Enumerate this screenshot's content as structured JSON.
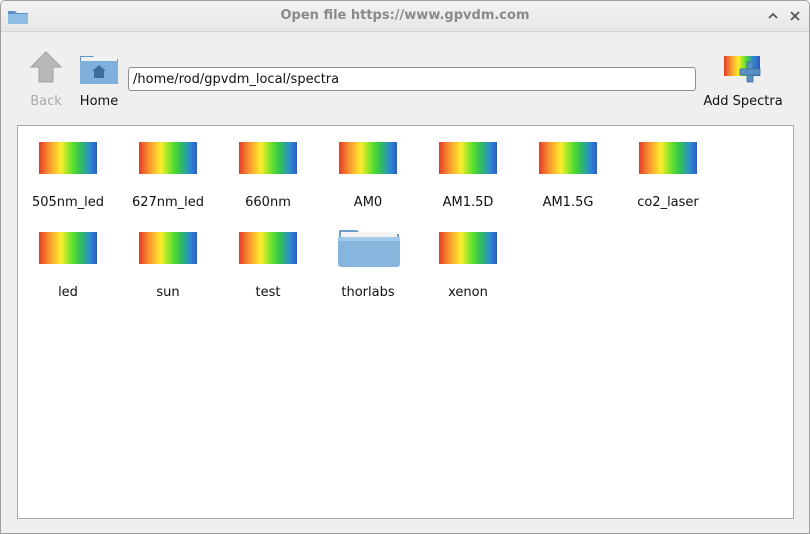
{
  "window": {
    "title": "Open file https://www.gpvdm.com"
  },
  "toolbar": {
    "back_label": "Back",
    "home_label": "Home",
    "add_label": "Add Spectra",
    "path_value": "/home/rod/gpvdm_local/spectra"
  },
  "icons": {
    "title": "folder-icon",
    "back": "arrow-up-icon",
    "home": "home-folder-icon",
    "add": "add-spectra-icon",
    "spectrum": "spectrum-file-icon",
    "folder": "folder-icon"
  },
  "colors": {
    "back_disabled": "#a9a9a9",
    "folder_blue": "#7aaed6",
    "add_plus": "#5a8fc2"
  },
  "files": [
    {
      "name": "505nm_led",
      "type": "spectrum"
    },
    {
      "name": "627nm_led",
      "type": "spectrum"
    },
    {
      "name": "660nm",
      "type": "spectrum"
    },
    {
      "name": "AM0",
      "type": "spectrum"
    },
    {
      "name": "AM1.5D",
      "type": "spectrum"
    },
    {
      "name": "AM1.5G",
      "type": "spectrum"
    },
    {
      "name": "co2_laser",
      "type": "spectrum"
    },
    {
      "name": "led",
      "type": "spectrum"
    },
    {
      "name": "sun",
      "type": "spectrum"
    },
    {
      "name": "test",
      "type": "spectrum"
    },
    {
      "name": "thorlabs",
      "type": "folder"
    },
    {
      "name": "xenon",
      "type": "spectrum"
    }
  ]
}
